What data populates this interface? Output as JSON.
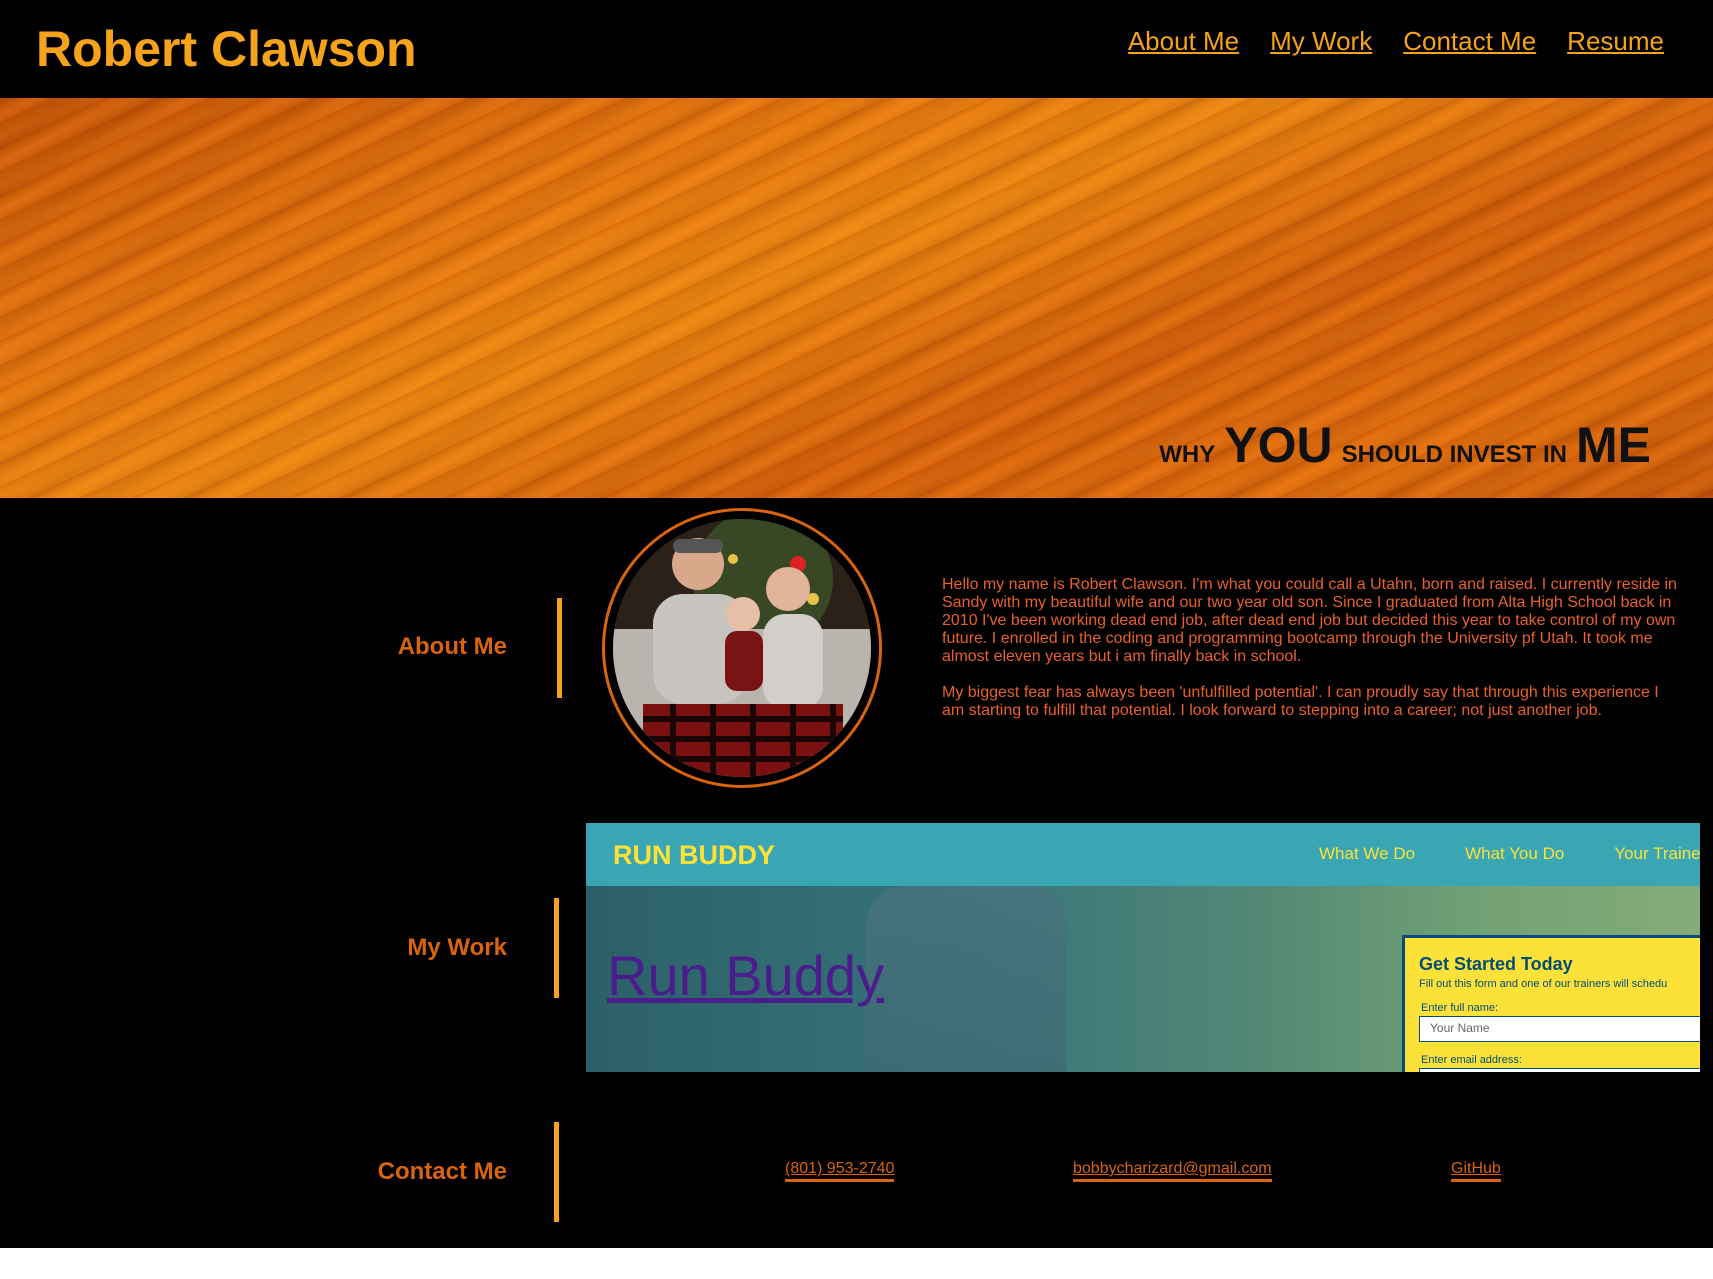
{
  "header": {
    "title": "Robert Clawson",
    "nav": [
      "About Me",
      "My Work",
      "Contact Me",
      "Resume"
    ]
  },
  "hero": {
    "tagline_why": "WHY",
    "tagline_you": "YOU",
    "tagline_should": "SHOULD INVEST IN",
    "tagline_me": "ME"
  },
  "about": {
    "label": "About Me",
    "paragraph1": "Hello my name is Robert Clawson. I'm what you could call a Utahn, born and raised. I currently reside in Sandy with my beautiful wife and our two year old son. Since I graduated from Alta High School back in 2010 I've been working dead end job, after dead end job but decided this year to take control of my own future. I enrolled in the coding and programming bootcamp through the University pf Utah. It took me almost eleven years but i am finally back in school.",
    "paragraph2": "My biggest fear has always been 'unfulfilled potential'. I can proudly say that through this experience I am starting to fulfill that potential. I look forward to stepping into a career; not just another job."
  },
  "work": {
    "label": "My Work",
    "project_link": "Run Buddy",
    "preview": {
      "brand": "RUN BUDDY",
      "nav": [
        "What We Do",
        "What You Do",
        "Your Traine"
      ],
      "form_title": "Get Started Today",
      "form_subtitle": "Fill out this form and one of our trainers will schedu",
      "name_label": "Enter full name:",
      "name_placeholder": "Your Name",
      "email_label": "Enter email address:"
    }
  },
  "contact": {
    "label": "Contact Me",
    "phone": "(801) 953-2740",
    "email": "bobbycharizard@gmail.com",
    "github": "GitHub"
  },
  "colors": {
    "accent_yellow": "#f5a31a",
    "accent_orange": "#d9640e",
    "background": "#000000"
  }
}
